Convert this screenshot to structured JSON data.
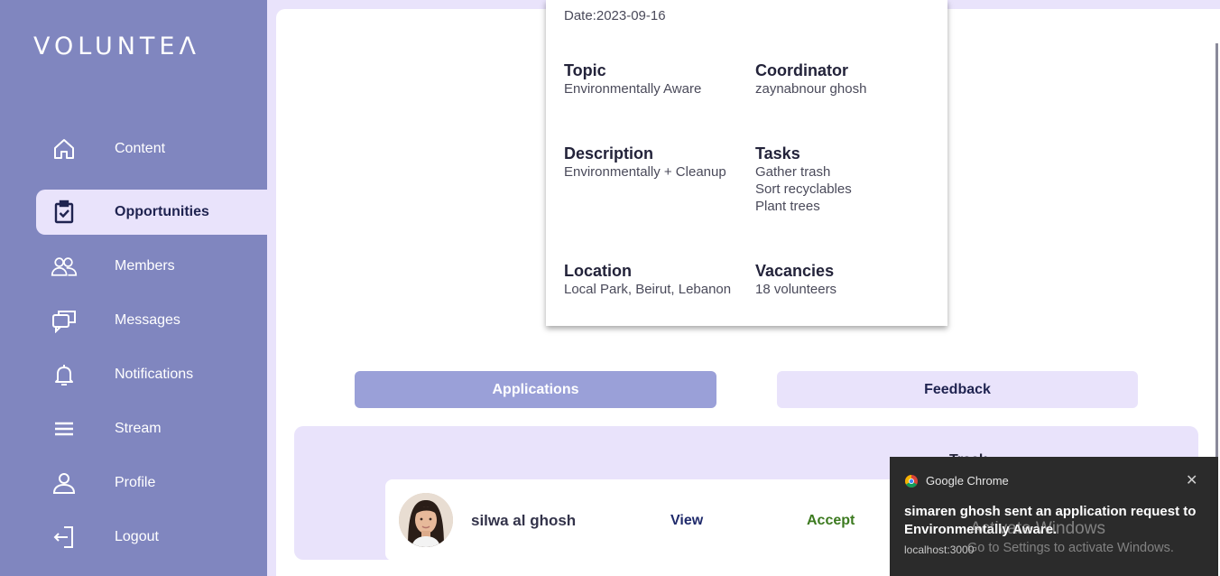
{
  "brand": {
    "logo": "VOLUNTEΛ"
  },
  "sidebar": {
    "items": [
      {
        "label": "Content",
        "icon": "home-icon"
      },
      {
        "label": "Opportunities",
        "icon": "clipboard-check-icon",
        "active": true
      },
      {
        "label": "Members",
        "icon": "users-icon"
      },
      {
        "label": "Messages",
        "icon": "chat-icon"
      },
      {
        "label": "Notifications",
        "icon": "bell-icon"
      },
      {
        "label": "Stream",
        "icon": "menu-icon"
      },
      {
        "label": "Profile",
        "icon": "user-icon"
      },
      {
        "label": "Logout",
        "icon": "logout-icon"
      }
    ]
  },
  "opportunity": {
    "date": "Date:2023-09-16",
    "topic_label": "Topic",
    "topic": "Environmentally Aware",
    "coordinator_label": "Coordinator",
    "coordinator": "zaynabnour ghosh",
    "description_label": "Description",
    "description": "Environmentally + Cleanup",
    "tasks_label": "Tasks",
    "tasks": [
      "Gather trash",
      "Sort recyclables",
      "Plant trees"
    ],
    "location_label": "Location",
    "location": "Local Park, Beirut, Lebanon",
    "vacancies_label": "Vacancies",
    "vacancies": "18 volunteers"
  },
  "tabs": {
    "applications": "Applications",
    "feedback": "Feedback"
  },
  "applications": {
    "heading": "Track",
    "items": [
      {
        "name": "silwa al ghosh",
        "view": "View",
        "accept": "Accept"
      }
    ]
  },
  "notification": {
    "app": "Google Chrome",
    "message": "simaren ghosh sent an application request to Environmentally Aware.",
    "source": "localhost:3000",
    "close": "✕"
  },
  "watermark": {
    "title": "Activate Windows",
    "subtitle": "Go to Settings to activate Windows."
  },
  "colors": {
    "sidebar": "#8086bf",
    "accent": "#9aa0d8",
    "background": "#e9e3fb",
    "accept": "#3c7a1f",
    "view": "#1f2a6b"
  }
}
